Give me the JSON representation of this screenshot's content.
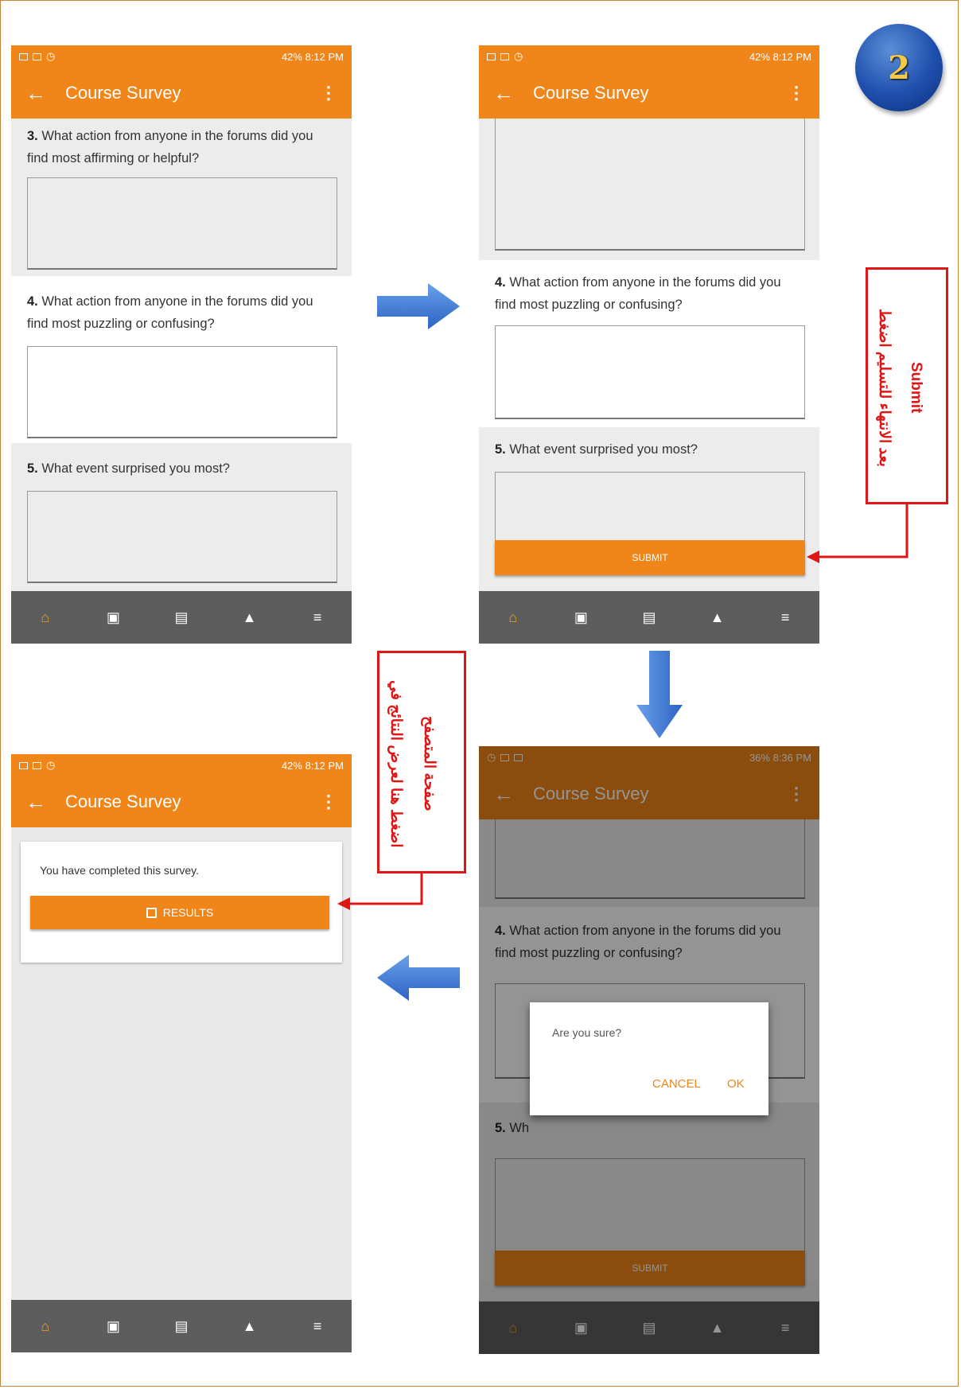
{
  "badge": {
    "step_number": "2"
  },
  "status_bar": {
    "left_icons": [
      "gallery-icon",
      "video-icon",
      "clock-icon"
    ],
    "right_text_1": "42% 8:12 PM",
    "right_text_4": "36% 8:36 PM"
  },
  "app_bar": {
    "title": "Course Survey"
  },
  "questions": {
    "q3": {
      "number": "3.",
      "text": "What action from anyone in the forums did you find most affirming or helpful?"
    },
    "q4": {
      "number": "4.",
      "text": "What action from anyone in the forums did you find most puzzling or confusing?"
    },
    "q5": {
      "number": "5.",
      "text": "What event surprised you most?"
    },
    "q5_partial": "Wh"
  },
  "submit_label": "SUBMIT",
  "completed": {
    "message": "You have completed this survey.",
    "results_label": "RESULTS"
  },
  "dialog": {
    "message": "Are you sure?",
    "cancel_label": "CANCEL",
    "ok_label": "OK"
  },
  "nav_items": [
    "home-icon",
    "calendar-icon",
    "forum-icon",
    "notifications-icon",
    "menu-icon"
  ],
  "callouts": {
    "submit_note_ar": "بعد الانتهاء للتسليم اضغط",
    "submit_note_en": "Submit",
    "results_note_line1": "اضغط هنا لعرض النتائج في",
    "results_note_line2": "صفحة المتصفح"
  },
  "colors": {
    "accent": "#f08519",
    "navbar": "#5d5d5d",
    "callout_red": "#e01616",
    "arrow_blue": "#3b78d6"
  }
}
